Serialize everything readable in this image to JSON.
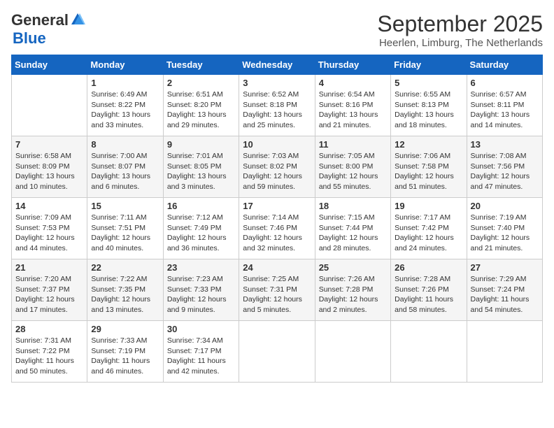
{
  "header": {
    "logo_general": "General",
    "logo_blue": "Blue",
    "month": "September 2025",
    "location": "Heerlen, Limburg, The Netherlands"
  },
  "days_of_week": [
    "Sunday",
    "Monday",
    "Tuesday",
    "Wednesday",
    "Thursday",
    "Friday",
    "Saturday"
  ],
  "weeks": [
    [
      {
        "day": "",
        "info": ""
      },
      {
        "day": "1",
        "info": "Sunrise: 6:49 AM\nSunset: 8:22 PM\nDaylight: 13 hours\nand 33 minutes."
      },
      {
        "day": "2",
        "info": "Sunrise: 6:51 AM\nSunset: 8:20 PM\nDaylight: 13 hours\nand 29 minutes."
      },
      {
        "day": "3",
        "info": "Sunrise: 6:52 AM\nSunset: 8:18 PM\nDaylight: 13 hours\nand 25 minutes."
      },
      {
        "day": "4",
        "info": "Sunrise: 6:54 AM\nSunset: 8:16 PM\nDaylight: 13 hours\nand 21 minutes."
      },
      {
        "day": "5",
        "info": "Sunrise: 6:55 AM\nSunset: 8:13 PM\nDaylight: 13 hours\nand 18 minutes."
      },
      {
        "day": "6",
        "info": "Sunrise: 6:57 AM\nSunset: 8:11 PM\nDaylight: 13 hours\nand 14 minutes."
      }
    ],
    [
      {
        "day": "7",
        "info": "Sunrise: 6:58 AM\nSunset: 8:09 PM\nDaylight: 13 hours\nand 10 minutes."
      },
      {
        "day": "8",
        "info": "Sunrise: 7:00 AM\nSunset: 8:07 PM\nDaylight: 13 hours\nand 6 minutes."
      },
      {
        "day": "9",
        "info": "Sunrise: 7:01 AM\nSunset: 8:05 PM\nDaylight: 13 hours\nand 3 minutes."
      },
      {
        "day": "10",
        "info": "Sunrise: 7:03 AM\nSunset: 8:02 PM\nDaylight: 12 hours\nand 59 minutes."
      },
      {
        "day": "11",
        "info": "Sunrise: 7:05 AM\nSunset: 8:00 PM\nDaylight: 12 hours\nand 55 minutes."
      },
      {
        "day": "12",
        "info": "Sunrise: 7:06 AM\nSunset: 7:58 PM\nDaylight: 12 hours\nand 51 minutes."
      },
      {
        "day": "13",
        "info": "Sunrise: 7:08 AM\nSunset: 7:56 PM\nDaylight: 12 hours\nand 47 minutes."
      }
    ],
    [
      {
        "day": "14",
        "info": "Sunrise: 7:09 AM\nSunset: 7:53 PM\nDaylight: 12 hours\nand 44 minutes."
      },
      {
        "day": "15",
        "info": "Sunrise: 7:11 AM\nSunset: 7:51 PM\nDaylight: 12 hours\nand 40 minutes."
      },
      {
        "day": "16",
        "info": "Sunrise: 7:12 AM\nSunset: 7:49 PM\nDaylight: 12 hours\nand 36 minutes."
      },
      {
        "day": "17",
        "info": "Sunrise: 7:14 AM\nSunset: 7:46 PM\nDaylight: 12 hours\nand 32 minutes."
      },
      {
        "day": "18",
        "info": "Sunrise: 7:15 AM\nSunset: 7:44 PM\nDaylight: 12 hours\nand 28 minutes."
      },
      {
        "day": "19",
        "info": "Sunrise: 7:17 AM\nSunset: 7:42 PM\nDaylight: 12 hours\nand 24 minutes."
      },
      {
        "day": "20",
        "info": "Sunrise: 7:19 AM\nSunset: 7:40 PM\nDaylight: 12 hours\nand 21 minutes."
      }
    ],
    [
      {
        "day": "21",
        "info": "Sunrise: 7:20 AM\nSunset: 7:37 PM\nDaylight: 12 hours\nand 17 minutes."
      },
      {
        "day": "22",
        "info": "Sunrise: 7:22 AM\nSunset: 7:35 PM\nDaylight: 12 hours\nand 13 minutes."
      },
      {
        "day": "23",
        "info": "Sunrise: 7:23 AM\nSunset: 7:33 PM\nDaylight: 12 hours\nand 9 minutes."
      },
      {
        "day": "24",
        "info": "Sunrise: 7:25 AM\nSunset: 7:31 PM\nDaylight: 12 hours\nand 5 minutes."
      },
      {
        "day": "25",
        "info": "Sunrise: 7:26 AM\nSunset: 7:28 PM\nDaylight: 12 hours\nand 2 minutes."
      },
      {
        "day": "26",
        "info": "Sunrise: 7:28 AM\nSunset: 7:26 PM\nDaylight: 11 hours\nand 58 minutes."
      },
      {
        "day": "27",
        "info": "Sunrise: 7:29 AM\nSunset: 7:24 PM\nDaylight: 11 hours\nand 54 minutes."
      }
    ],
    [
      {
        "day": "28",
        "info": "Sunrise: 7:31 AM\nSunset: 7:22 PM\nDaylight: 11 hours\nand 50 minutes."
      },
      {
        "day": "29",
        "info": "Sunrise: 7:33 AM\nSunset: 7:19 PM\nDaylight: 11 hours\nand 46 minutes."
      },
      {
        "day": "30",
        "info": "Sunrise: 7:34 AM\nSunset: 7:17 PM\nDaylight: 11 hours\nand 42 minutes."
      },
      {
        "day": "",
        "info": ""
      },
      {
        "day": "",
        "info": ""
      },
      {
        "day": "",
        "info": ""
      },
      {
        "day": "",
        "info": ""
      }
    ]
  ]
}
